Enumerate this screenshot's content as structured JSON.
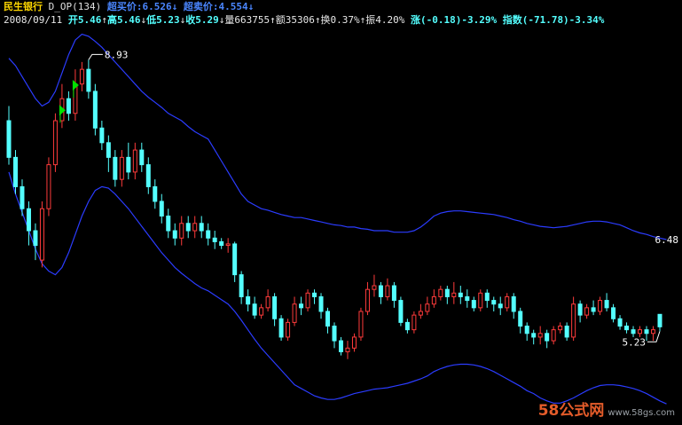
{
  "header": {
    "stock_name": "民生银行",
    "formula": "D_OP(134)",
    "sell_label": "超买价:6.526",
    "buy_label": "超卖价:4.554",
    "date": "2008/09/11",
    "open": "开5.46",
    "high": "高5.46",
    "low": "低5.23",
    "close": "收5.29",
    "volume": "量663755",
    "amount": "额35306",
    "turnover": "换0.37%",
    "amplitude": "振4.20%",
    "change": "涨(-0.18)-3.29%",
    "index": "指数(-71.78)-3.34%"
  },
  "watermark": {
    "logo": "58公式网",
    "url": "www.58gs.com"
  },
  "chart_data": {
    "type": "candlestick",
    "ylim": [
      4.0,
      9.6
    ],
    "annotations": [
      {
        "label": "8.93",
        "value": 8.93,
        "index": 12
      },
      {
        "label": "5.23",
        "value": 5.23,
        "index": 98
      },
      {
        "label": "6.48",
        "value": 6.48,
        "index": 99
      }
    ],
    "candles": [
      [
        8.1,
        7.6,
        8.3,
        7.5
      ],
      [
        7.6,
        7.2,
        7.7,
        7.1
      ],
      [
        7.2,
        6.9,
        7.3,
        6.8
      ],
      [
        6.9,
        6.6,
        7.0,
        6.4
      ],
      [
        6.6,
        6.4,
        6.7,
        6.2
      ],
      [
        6.2,
        6.9,
        7.0,
        6.1
      ],
      [
        6.9,
        7.5,
        7.6,
        6.8
      ],
      [
        7.5,
        8.1,
        8.2,
        7.4
      ],
      [
        8.1,
        8.4,
        8.6,
        8.0
      ],
      [
        8.4,
        8.2,
        8.5,
        8.1
      ],
      [
        8.2,
        8.6,
        8.8,
        8.1
      ],
      [
        8.6,
        8.8,
        8.9,
        8.5
      ],
      [
        8.8,
        8.5,
        8.93,
        8.4
      ],
      [
        8.5,
        8.0,
        8.6,
        7.9
      ],
      [
        8.0,
        7.8,
        8.1,
        7.7
      ],
      [
        7.8,
        7.6,
        7.9,
        7.4
      ],
      [
        7.6,
        7.3,
        7.7,
        7.2
      ],
      [
        7.3,
        7.6,
        7.7,
        7.2
      ],
      [
        7.6,
        7.4,
        7.8,
        7.3
      ],
      [
        7.4,
        7.7,
        7.8,
        7.3
      ],
      [
        7.7,
        7.5,
        7.8,
        7.4
      ],
      [
        7.5,
        7.2,
        7.6,
        7.1
      ],
      [
        7.2,
        7.0,
        7.3,
        6.9
      ],
      [
        7.0,
        6.8,
        7.1,
        6.7
      ],
      [
        6.8,
        6.6,
        6.9,
        6.5
      ],
      [
        6.6,
        6.5,
        6.7,
        6.4
      ],
      [
        6.5,
        6.7,
        6.8,
        6.4
      ],
      [
        6.7,
        6.6,
        6.8,
        6.5
      ],
      [
        6.6,
        6.7,
        6.8,
        6.5
      ],
      [
        6.7,
        6.6,
        6.8,
        6.5
      ],
      [
        6.6,
        6.5,
        6.7,
        6.4
      ],
      [
        6.5,
        6.45,
        6.6,
        6.35
      ],
      [
        6.45,
        6.4,
        6.5,
        6.35
      ],
      [
        6.4,
        6.42,
        6.5,
        6.3
      ],
      [
        6.42,
        6.0,
        6.45,
        5.9
      ],
      [
        6.0,
        5.7,
        6.05,
        5.6
      ],
      [
        5.7,
        5.6,
        5.8,
        5.5
      ],
      [
        5.6,
        5.45,
        5.7,
        5.4
      ],
      [
        5.45,
        5.55,
        5.6,
        5.4
      ],
      [
        5.55,
        5.7,
        5.8,
        5.5
      ],
      [
        5.7,
        5.4,
        5.75,
        5.3
      ],
      [
        5.4,
        5.15,
        5.45,
        5.1
      ],
      [
        5.15,
        5.35,
        5.4,
        5.1
      ],
      [
        5.35,
        5.6,
        5.7,
        5.3
      ],
      [
        5.6,
        5.55,
        5.7,
        5.45
      ],
      [
        5.55,
        5.75,
        5.8,
        5.5
      ],
      [
        5.75,
        5.7,
        5.8,
        5.6
      ],
      [
        5.7,
        5.5,
        5.75,
        5.4
      ],
      [
        5.5,
        5.3,
        5.55,
        5.2
      ],
      [
        5.3,
        5.1,
        5.35,
        5.0
      ],
      [
        5.1,
        4.95,
        5.15,
        4.9
      ],
      [
        4.95,
        5.0,
        5.1,
        4.85
      ],
      [
        5.0,
        5.15,
        5.2,
        4.95
      ],
      [
        5.15,
        5.5,
        5.55,
        5.1
      ],
      [
        5.5,
        5.8,
        5.9,
        5.45
      ],
      [
        5.8,
        5.85,
        6.0,
        5.7
      ],
      [
        5.85,
        5.7,
        5.9,
        5.6
      ],
      [
        5.7,
        5.85,
        5.95,
        5.65
      ],
      [
        5.85,
        5.65,
        5.9,
        5.55
      ],
      [
        5.65,
        5.35,
        5.7,
        5.3
      ],
      [
        5.35,
        5.25,
        5.4,
        5.2
      ],
      [
        5.25,
        5.45,
        5.5,
        5.2
      ],
      [
        5.45,
        5.5,
        5.6,
        5.4
      ],
      [
        5.5,
        5.6,
        5.7,
        5.45
      ],
      [
        5.6,
        5.7,
        5.8,
        5.55
      ],
      [
        5.7,
        5.8,
        5.85,
        5.65
      ],
      [
        5.8,
        5.7,
        5.85,
        5.6
      ],
      [
        5.7,
        5.75,
        5.9,
        5.6
      ],
      [
        5.75,
        5.7,
        5.85,
        5.6
      ],
      [
        5.7,
        5.65,
        5.8,
        5.55
      ],
      [
        5.65,
        5.55,
        5.7,
        5.5
      ],
      [
        5.55,
        5.75,
        5.8,
        5.5
      ],
      [
        5.75,
        5.65,
        5.8,
        5.55
      ],
      [
        5.65,
        5.6,
        5.7,
        5.5
      ],
      [
        5.6,
        5.55,
        5.7,
        5.45
      ],
      [
        5.55,
        5.7,
        5.75,
        5.5
      ],
      [
        5.7,
        5.5,
        5.75,
        5.4
      ],
      [
        5.5,
        5.3,
        5.55,
        5.2
      ],
      [
        5.3,
        5.2,
        5.35,
        5.1
      ],
      [
        5.2,
        5.15,
        5.25,
        5.05
      ],
      [
        5.15,
        5.2,
        5.3,
        5.05
      ],
      [
        5.2,
        5.1,
        5.25,
        5.0
      ],
      [
        5.1,
        5.25,
        5.3,
        5.05
      ],
      [
        5.25,
        5.3,
        5.35,
        5.2
      ],
      [
        5.3,
        5.15,
        5.35,
        5.1
      ],
      [
        5.15,
        5.6,
        5.7,
        5.1
      ],
      [
        5.6,
        5.45,
        5.65,
        5.35
      ],
      [
        5.45,
        5.55,
        5.6,
        5.4
      ],
      [
        5.55,
        5.5,
        5.65,
        5.45
      ],
      [
        5.5,
        5.65,
        5.7,
        5.45
      ],
      [
        5.65,
        5.55,
        5.75,
        5.5
      ],
      [
        5.55,
        5.4,
        5.6,
        5.35
      ],
      [
        5.4,
        5.3,
        5.45,
        5.25
      ],
      [
        5.3,
        5.25,
        5.35,
        5.2
      ],
      [
        5.25,
        5.2,
        5.3,
        5.15
      ],
      [
        5.2,
        5.25,
        5.3,
        5.15
      ],
      [
        5.25,
        5.2,
        5.3,
        5.1
      ],
      [
        5.2,
        5.25,
        5.3,
        5.1
      ],
      [
        5.46,
        5.29,
        5.46,
        5.23
      ]
    ],
    "upper_band": [
      8.95,
      8.85,
      8.7,
      8.55,
      8.4,
      8.3,
      8.35,
      8.5,
      8.75,
      9.0,
      9.2,
      9.28,
      9.25,
      9.18,
      9.1,
      9.0,
      8.9,
      8.8,
      8.7,
      8.6,
      8.5,
      8.42,
      8.35,
      8.28,
      8.2,
      8.15,
      8.1,
      8.02,
      7.95,
      7.9,
      7.85,
      7.7,
      7.55,
      7.4,
      7.25,
      7.1,
      7.0,
      6.95,
      6.9,
      6.88,
      6.85,
      6.82,
      6.8,
      6.78,
      6.78,
      6.76,
      6.74,
      6.72,
      6.7,
      6.68,
      6.67,
      6.65,
      6.65,
      6.63,
      6.62,
      6.6,
      6.6,
      6.6,
      6.58,
      6.58,
      6.58,
      6.6,
      6.65,
      6.72,
      6.8,
      6.84,
      6.86,
      6.87,
      6.87,
      6.86,
      6.85,
      6.84,
      6.83,
      6.82,
      6.8,
      6.78,
      6.75,
      6.73,
      6.7,
      6.68,
      6.66,
      6.65,
      6.64,
      6.65,
      6.66,
      6.68,
      6.7,
      6.72,
      6.73,
      6.73,
      6.72,
      6.7,
      6.68,
      6.64,
      6.6,
      6.57,
      6.55,
      6.52,
      6.5,
      6.48
    ],
    "lower_band": [
      7.4,
      7.1,
      6.85,
      6.6,
      6.35,
      6.15,
      6.05,
      6.0,
      6.1,
      6.3,
      6.55,
      6.8,
      7.0,
      7.15,
      7.2,
      7.18,
      7.1,
      7.0,
      6.9,
      6.78,
      6.66,
      6.54,
      6.42,
      6.3,
      6.2,
      6.1,
      6.02,
      5.95,
      5.88,
      5.82,
      5.78,
      5.72,
      5.66,
      5.6,
      5.5,
      5.38,
      5.25,
      5.12,
      5.0,
      4.9,
      4.8,
      4.7,
      4.6,
      4.5,
      4.45,
      4.4,
      4.35,
      4.32,
      4.3,
      4.3,
      4.32,
      4.35,
      4.38,
      4.4,
      4.42,
      4.44,
      4.45,
      4.46,
      4.48,
      4.5,
      4.52,
      4.55,
      4.58,
      4.62,
      4.68,
      4.72,
      4.75,
      4.77,
      4.78,
      4.78,
      4.77,
      4.75,
      4.72,
      4.68,
      4.63,
      4.58,
      4.53,
      4.48,
      4.42,
      4.38,
      4.32,
      4.28,
      4.25,
      4.25,
      4.28,
      4.32,
      4.37,
      4.42,
      4.46,
      4.49,
      4.5,
      4.5,
      4.49,
      4.47,
      4.45,
      4.42,
      4.38,
      4.33,
      4.28,
      4.24
    ]
  }
}
